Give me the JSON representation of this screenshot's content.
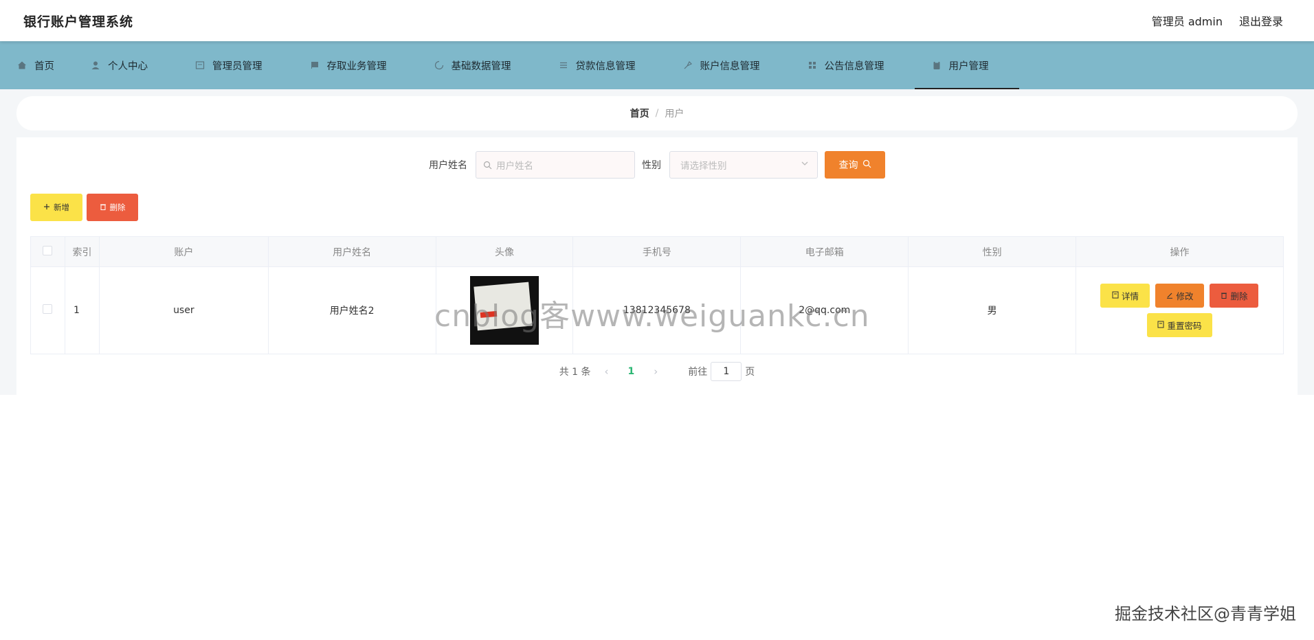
{
  "header": {
    "title": "银行账户管理系统",
    "user_label": "管理员 admin",
    "logout_label": "退出登录"
  },
  "nav": {
    "items": [
      {
        "label": "首页",
        "icon": "home-icon"
      },
      {
        "label": "个人中心",
        "icon": "user-icon"
      },
      {
        "label": "管理员管理",
        "icon": "admin-icon"
      },
      {
        "label": "存取业务管理",
        "icon": "deposit-icon"
      },
      {
        "label": "基础数据管理",
        "icon": "data-icon"
      },
      {
        "label": "贷款信息管理",
        "icon": "loan-icon"
      },
      {
        "label": "账户信息管理",
        "icon": "account-icon"
      },
      {
        "label": "公告信息管理",
        "icon": "notice-icon"
      },
      {
        "label": "用户管理",
        "icon": "users-icon",
        "active": true
      }
    ]
  },
  "breadcrumb": {
    "home": "首页",
    "separator": "/",
    "current": "用户"
  },
  "search": {
    "name_label": "用户姓名",
    "name_placeholder": "用户姓名",
    "gender_label": "性别",
    "gender_placeholder": "请选择性别",
    "query_label": "查询"
  },
  "actions": {
    "add_label": "新增",
    "delete_label": "删除"
  },
  "table": {
    "columns": [
      "索引",
      "账户",
      "用户姓名",
      "头像",
      "手机号",
      "电子邮箱",
      "性别",
      "操作"
    ],
    "rows": [
      {
        "index": "1",
        "account": "user",
        "name": "用户姓名2",
        "phone": "13812345678",
        "email": "2@qq.com",
        "gender": "男"
      }
    ],
    "row_actions": {
      "detail": "详情",
      "edit": "修改",
      "delete": "删除",
      "reset": "重置密码"
    }
  },
  "pagination": {
    "total_text": "共 1 条",
    "current_page": "1",
    "goto_label": "前往",
    "goto_value": "1",
    "page_suffix": "页"
  },
  "watermarks": {
    "center": "cnblog客www.weiguankc.cn",
    "corner": "掘金技术社区@青青学姐"
  },
  "colors": {
    "nav_bg": "#7fb8ca",
    "yellow": "#fbe248",
    "orange": "#f0822c",
    "red": "#ec5c3e",
    "green_page": "#2bb673"
  }
}
